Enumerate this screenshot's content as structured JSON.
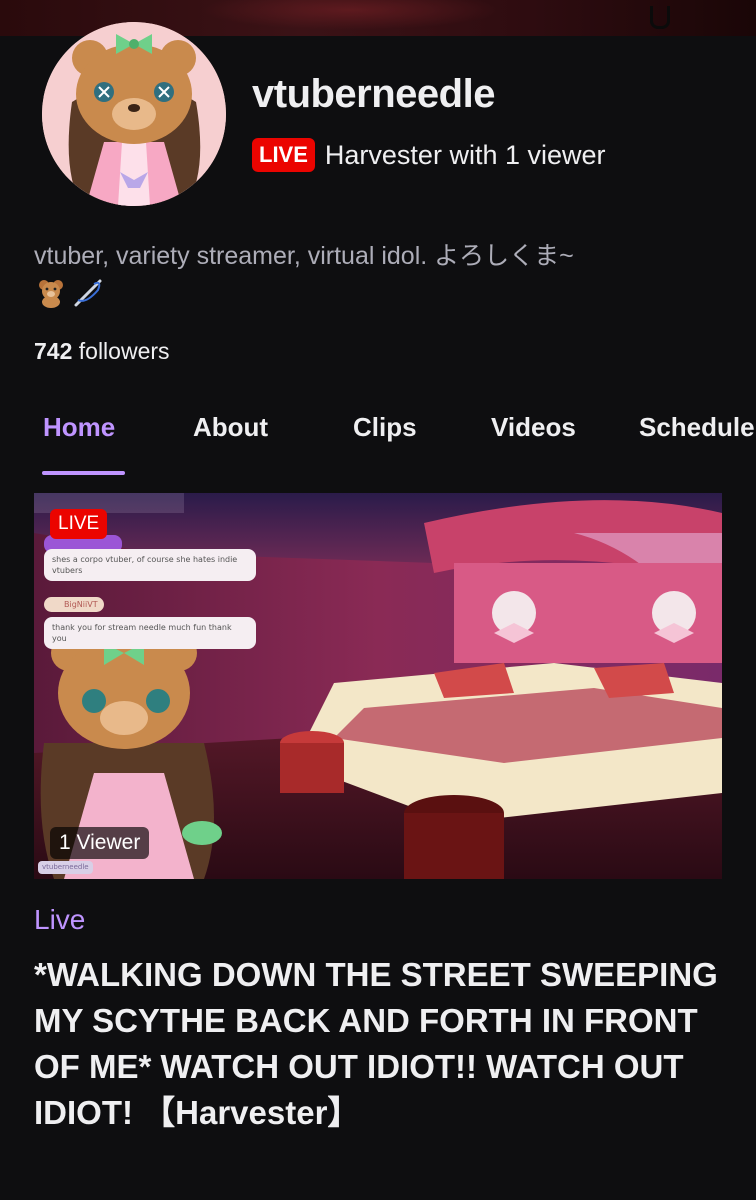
{
  "channel": {
    "name": "vtuberneedle",
    "live_badge": "LIVE",
    "game": "Harvester",
    "with_text": "with",
    "viewer_count": "1",
    "viewer_word": "viewer",
    "bio": "vtuber, variety streamer, virtual idol. よろしくま~",
    "bio_emojis": [
      "teddy-bear-emoji",
      "sewing-needle-emoji"
    ],
    "followers_count": "742",
    "followers_label": "followers"
  },
  "tabs": [
    {
      "label": "Home",
      "active": true
    },
    {
      "label": "About",
      "active": false
    },
    {
      "label": "Clips",
      "active": false
    },
    {
      "label": "Videos",
      "active": false
    },
    {
      "label": "Schedule",
      "active": false
    }
  ],
  "preview": {
    "live_badge": "LIVE",
    "viewer_pill": "1 Viewer",
    "chat": [
      {
        "text": "shes a corpo vtuber, of course she hates indie vtubers"
      },
      {
        "user": "BigNiiVT",
        "text": "thank you for stream needle much fun thank you"
      }
    ],
    "overlay_handle": "vtuberneedle"
  },
  "stream": {
    "status": "Live",
    "title": "*WALKING DOWN THE STREET SWEEPING MY SCYTHE BACK AND FORTH IN FRONT OF ME* WATCH OUT IDIOT!! WATCH OUT IDIOT! 【Harvester】"
  },
  "colors": {
    "accent": "#bf94ff",
    "live_red": "#eb0400",
    "background": "#0e0e10",
    "muted_text": "#adadb8"
  }
}
